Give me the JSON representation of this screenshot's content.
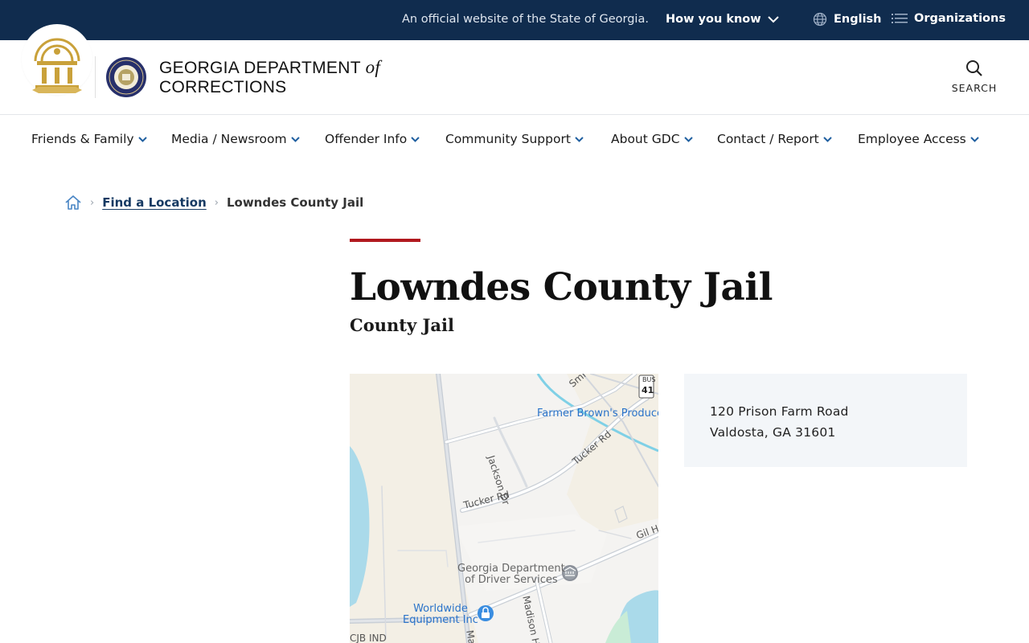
{
  "topbar": {
    "official_text": "An official website of the State of Georgia.",
    "how_you_know": "How you know",
    "language": "English",
    "organizations": "Organizations"
  },
  "header": {
    "brand_line1": "GEORGIA DEPARTMENT",
    "brand_of": "of",
    "brand_line2": "CORRECTIONS",
    "search_label": "SEARCH"
  },
  "nav": {
    "items": [
      {
        "label": "Friends & Family"
      },
      {
        "label": "Media / Newsroom"
      },
      {
        "label": "Offender Info"
      },
      {
        "label": "Community Support"
      },
      {
        "label": "About GDC"
      },
      {
        "label": "Contact / Report"
      },
      {
        "label": "Employee Access"
      }
    ]
  },
  "breadcrumb": {
    "link": "Find a Location",
    "current": "Lowndes County Jail"
  },
  "page": {
    "title": "Lowndes County Jail",
    "subtitle": "County Jail"
  },
  "map": {
    "labels": {
      "tucker_rd_1": "Tucker Rd",
      "tucker_rd_2": "Tucker Rd",
      "jackson_dr": "Jackson Dr",
      "gil_h": "Gil H",
      "smi": "Smi",
      "madison_h": "Madison Hei",
      "cjb": "CJB IND",
      "ma": "Ma",
      "route_bus": "BUS",
      "route_num": "41"
    },
    "pois": {
      "farmer_browns": "Farmer Brown's Produce",
      "dds_line1": "Georgia Department",
      "dds_line2": "of Driver Services",
      "worldwide_line1": "Worldwide",
      "worldwide_line2": "Equipment Inc"
    }
  },
  "address": {
    "line1": "120 Prison Farm Road",
    "line2": "Valdosta, GA 31601"
  },
  "colors": {
    "topbar_bg": "#102c4e",
    "accent_red": "#b1181e",
    "link_blue": "#163a63",
    "nav_chevron": "#1f5fa0"
  }
}
